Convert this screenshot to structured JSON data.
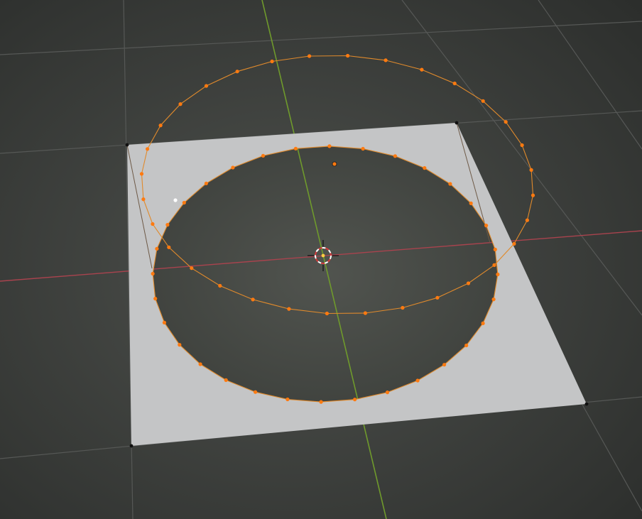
{
  "viewport": {
    "mode": "edit-mode",
    "colors": {
      "background_center": "#4e514d",
      "background_edge": "#2c2e2c",
      "grid_line": "#565856",
      "x_axis": "#a9434e",
      "y_axis": "#6f9a2c",
      "face": "#c4c5c6",
      "selected_edge": "#e08a2c",
      "selected_vertex": "#ff7a10",
      "unselected_vertex": "#101010",
      "unselected_edge": "#6e5a47",
      "cursor_ring_red": "#d83a3a",
      "cursor_ring_white": "#ffffff"
    },
    "icons": {
      "cursor": "3d-cursor-icon",
      "origin": "object-origin-icon"
    },
    "counts": {
      "inner_circle_vertices": 32,
      "outer_circle_vertices": 32,
      "plane_corners": 4
    }
  }
}
